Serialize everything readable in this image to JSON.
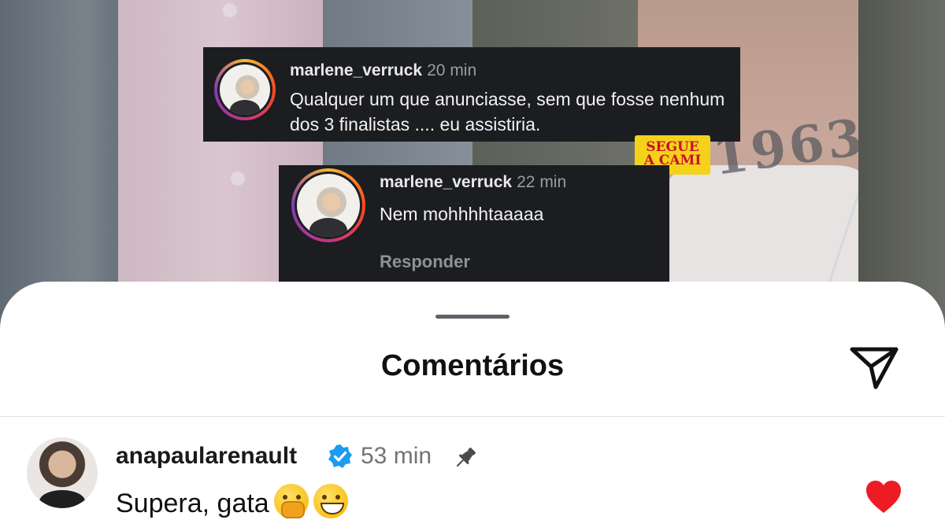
{
  "overlay_comments": [
    {
      "username": "marlene_verruck",
      "time": "20 min",
      "text": "Qualquer um que anunciasse, sem que fosse nenhum dos 3 finalistas .... eu assistiria."
    },
    {
      "username": "marlene_verruck",
      "time": "22 min",
      "text": "Nem mohhhhtaaaaa",
      "reply_label": "Responder"
    }
  ],
  "sticker": {
    "line1": "SEGUE",
    "line2": "A CAMI",
    "bg_color": "#f5d21a",
    "text_color": "#c8102e"
  },
  "tattoo_text": "1963",
  "sheet": {
    "title": "Comentários",
    "share_icon": "paper-plane-icon"
  },
  "comment": {
    "username": "anapaularenault",
    "verified_icon": "verified-badge-icon",
    "time": "53 min",
    "pin_icon": "pin-icon",
    "text": "Supera, gata",
    "emojis": [
      "hand-over-mouth-emoji",
      "grinning-sweat-emoji"
    ],
    "like_icon": "heart-icon",
    "liked": true,
    "like_color": "#ed1c24"
  }
}
